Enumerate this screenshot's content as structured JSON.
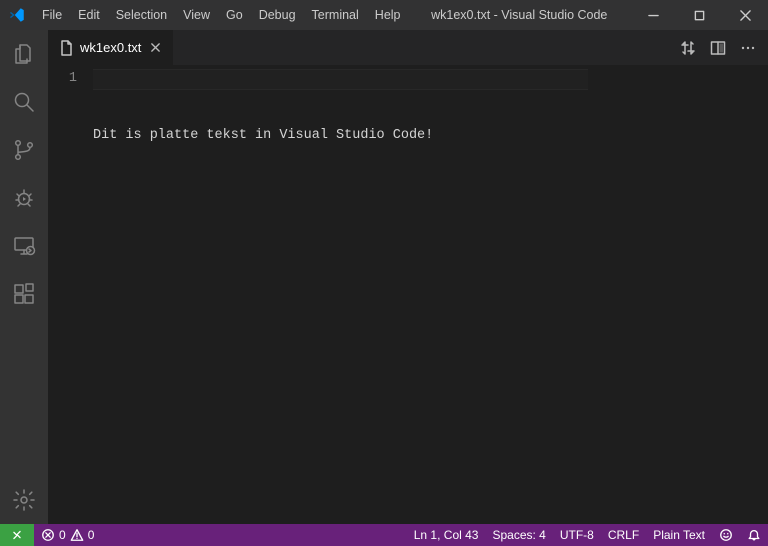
{
  "menubar": {
    "items": [
      "File",
      "Edit",
      "Selection",
      "View",
      "Go",
      "Debug",
      "Terminal",
      "Help"
    ]
  },
  "window": {
    "title": "wk1ex0.txt - Visual Studio Code"
  },
  "tabs": [
    {
      "label": "wk1ex0.txt"
    }
  ],
  "editor": {
    "line_numbers": [
      "1"
    ],
    "lines": [
      "Dit is platte tekst in Visual Studio Code!"
    ]
  },
  "statusbar": {
    "errors": "0",
    "warnings": "0",
    "ln_col": "Ln 1, Col 43",
    "spaces": "Spaces: 4",
    "encoding": "UTF-8",
    "eol": "CRLF",
    "language": "Plain Text"
  }
}
